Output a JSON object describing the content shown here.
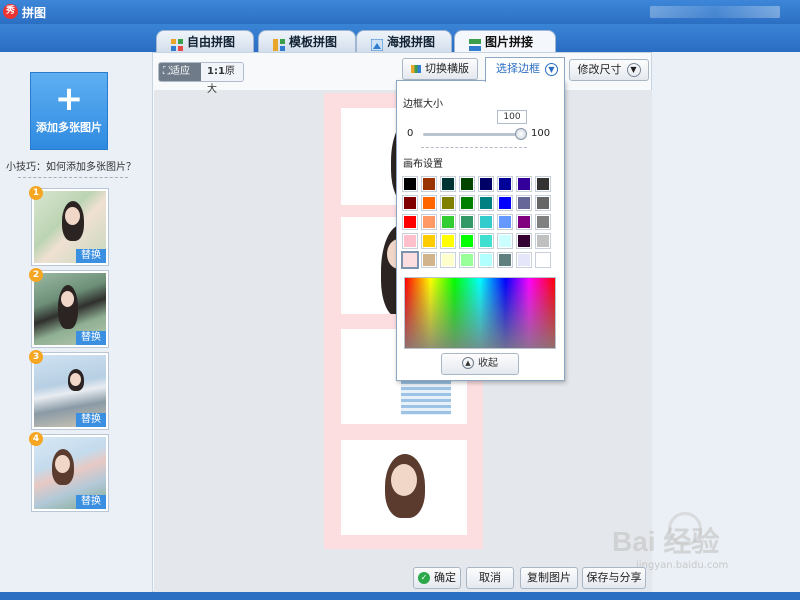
{
  "app": {
    "title": "拼图"
  },
  "tabs": [
    {
      "label": "自由拼图",
      "icon": "free-collage-icon",
      "color": "#e8a72a"
    },
    {
      "label": "模板拼图",
      "icon": "template-collage-icon",
      "color": "#3a9e4a"
    },
    {
      "label": "海报拼图",
      "icon": "poster-collage-icon",
      "color": "#2f7cd0"
    },
    {
      "label": "图片拼接",
      "icon": "image-join-icon",
      "color": "#3a9e4a",
      "active": true
    }
  ],
  "sidebar": {
    "add_button_label": "添加多张图片",
    "tip": "小技巧：如何添加多张图片？",
    "thumbnails": [
      {
        "number": "1",
        "replace_label": "替换"
      },
      {
        "number": "2",
        "replace_label": "替换"
      },
      {
        "number": "3",
        "replace_label": "替换"
      },
      {
        "number": "4",
        "replace_label": "替换"
      }
    ]
  },
  "toolbar": {
    "fit_label": "适应",
    "original_prefix": "1:1",
    "original_label": "原大",
    "switch_orientation_label": "切换横版",
    "select_border_label": "选择边框",
    "resize_label": "修改尺寸"
  },
  "border_popup": {
    "border_size_label": "边框大小",
    "border_size_value": "100",
    "slider_min": "0",
    "slider_max": "100",
    "slider_value": 100,
    "canvas_settings_label": "画布设置",
    "collapse_label": "收起",
    "swatches": [
      [
        "#000000",
        "#993300",
        "#003333",
        "#004400",
        "#000066",
        "#000099",
        "#330099",
        "#333333"
      ],
      [
        "#800000",
        "#ff6600",
        "#808000",
        "#008000",
        "#008080",
        "#0000ff",
        "#666699",
        "#666666"
      ],
      [
        "#ff0000",
        "#ff9966",
        "#33cc33",
        "#339966",
        "#33cccc",
        "#6699ff",
        "#800080",
        "#808080"
      ],
      [
        "#ffc0cb",
        "#ffcc00",
        "#ffff00",
        "#00ff00",
        "#40e0d0",
        "#ccffff",
        "#330033",
        "#c0c0c0"
      ],
      [
        "#fcdde0",
        "#d2b48c",
        "#ffffcc",
        "#99ff99",
        "#b2ffff",
        "#608080",
        "#e6e6fa",
        "#ffffff"
      ]
    ],
    "selected_swatch": "#fcdde0"
  },
  "canvas": {
    "background": "#fcdde0"
  },
  "actions": {
    "confirm_label": "确定",
    "cancel_label": "取消",
    "copy_label": "复制图片",
    "save_share_label": "保存与分享"
  },
  "watermark": {
    "text": "Bai 经验",
    "url_text": "jingyan.baidu.com"
  }
}
